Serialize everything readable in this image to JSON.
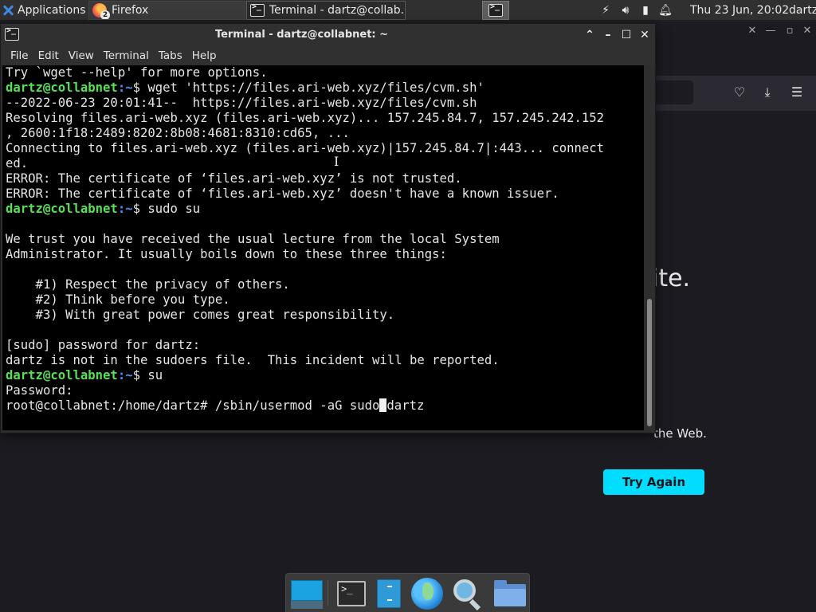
{
  "top_panel": {
    "apps_menu_label": "Applications",
    "tasks": [
      {
        "label": "Firefox",
        "badge": "2",
        "icon": "firefox-icon"
      },
      {
        "label": "Terminal - dartz@collab...",
        "icon": "terminal-icon"
      }
    ],
    "tray_icons": [
      "network-icon",
      "volume-icon",
      "battery-icon",
      "notification-bell-icon"
    ],
    "clock": "Thu 23 Jun, 20:02",
    "user": "dartz"
  },
  "firefox": {
    "heading_fragment": "ite.",
    "desc_fragment": "the Web.",
    "try_again_label": "Try Again",
    "accent_color": "#00ddff"
  },
  "terminal": {
    "title": "Terminal - dartz@collabnet: ~",
    "menu": [
      "File",
      "Edit",
      "View",
      "Terminal",
      "Tabs",
      "Help"
    ],
    "prompt_user": "dartz@collabnet",
    "prompt_path": ":~",
    "lines": [
      {
        "type": "text",
        "text": "Try `wget --help' for more options."
      },
      {
        "type": "prompt",
        "cmd": "$ wget 'https://files.ari-web.xyz/files/cvm.sh'"
      },
      {
        "type": "text",
        "text": "--2022-06-23 20:01:41--  https://files.ari-web.xyz/files/cvm.sh"
      },
      {
        "type": "text",
        "text": "Resolving files.ari-web.xyz (files.ari-web.xyz)... 157.245.84.7, 157.245.242.152"
      },
      {
        "type": "text",
        "text": ", 2600:1f18:2489:8202:8b08:4681:8310:cd65, ..."
      },
      {
        "type": "text",
        "text": "Connecting to files.ari-web.xyz (files.ari-web.xyz)|157.245.84.7|:443... connect"
      },
      {
        "type": "text",
        "text": "ed."
      },
      {
        "type": "text",
        "text": "ERROR: The certificate of ‘files.ari-web.xyz’ is not trusted."
      },
      {
        "type": "text",
        "text": "ERROR: The certificate of ‘files.ari-web.xyz’ doesn't have a known issuer."
      },
      {
        "type": "prompt",
        "cmd": "$ sudo su"
      },
      {
        "type": "text",
        "text": ""
      },
      {
        "type": "text",
        "text": "We trust you have received the usual lecture from the local System"
      },
      {
        "type": "text",
        "text": "Administrator. It usually boils down to these three things:"
      },
      {
        "type": "text",
        "text": ""
      },
      {
        "type": "text",
        "text": "    #1) Respect the privacy of others."
      },
      {
        "type": "text",
        "text": "    #2) Think before you type."
      },
      {
        "type": "text",
        "text": "    #3) With great power comes great responsibility."
      },
      {
        "type": "text",
        "text": ""
      },
      {
        "type": "text",
        "text": "[sudo] password for dartz:"
      },
      {
        "type": "text",
        "text": "dartz is not in the sudoers file.  This incident will be reported."
      },
      {
        "type": "prompt",
        "cmd": "$ su"
      },
      {
        "type": "text",
        "text": "Password:"
      }
    ],
    "root_prompt": "root@collabnet:/home/dartz# /sbin/usermod -aG sudo",
    "root_after_cursor": "dartz",
    "colors": {
      "prompt_user": "#55e055",
      "prompt_path": "#4f8ff7"
    }
  },
  "dock": {
    "items": [
      "desktop-icon",
      "terminal-icon",
      "file-manager-icon",
      "web-browser-icon",
      "search-icon",
      "folder-icon"
    ]
  }
}
